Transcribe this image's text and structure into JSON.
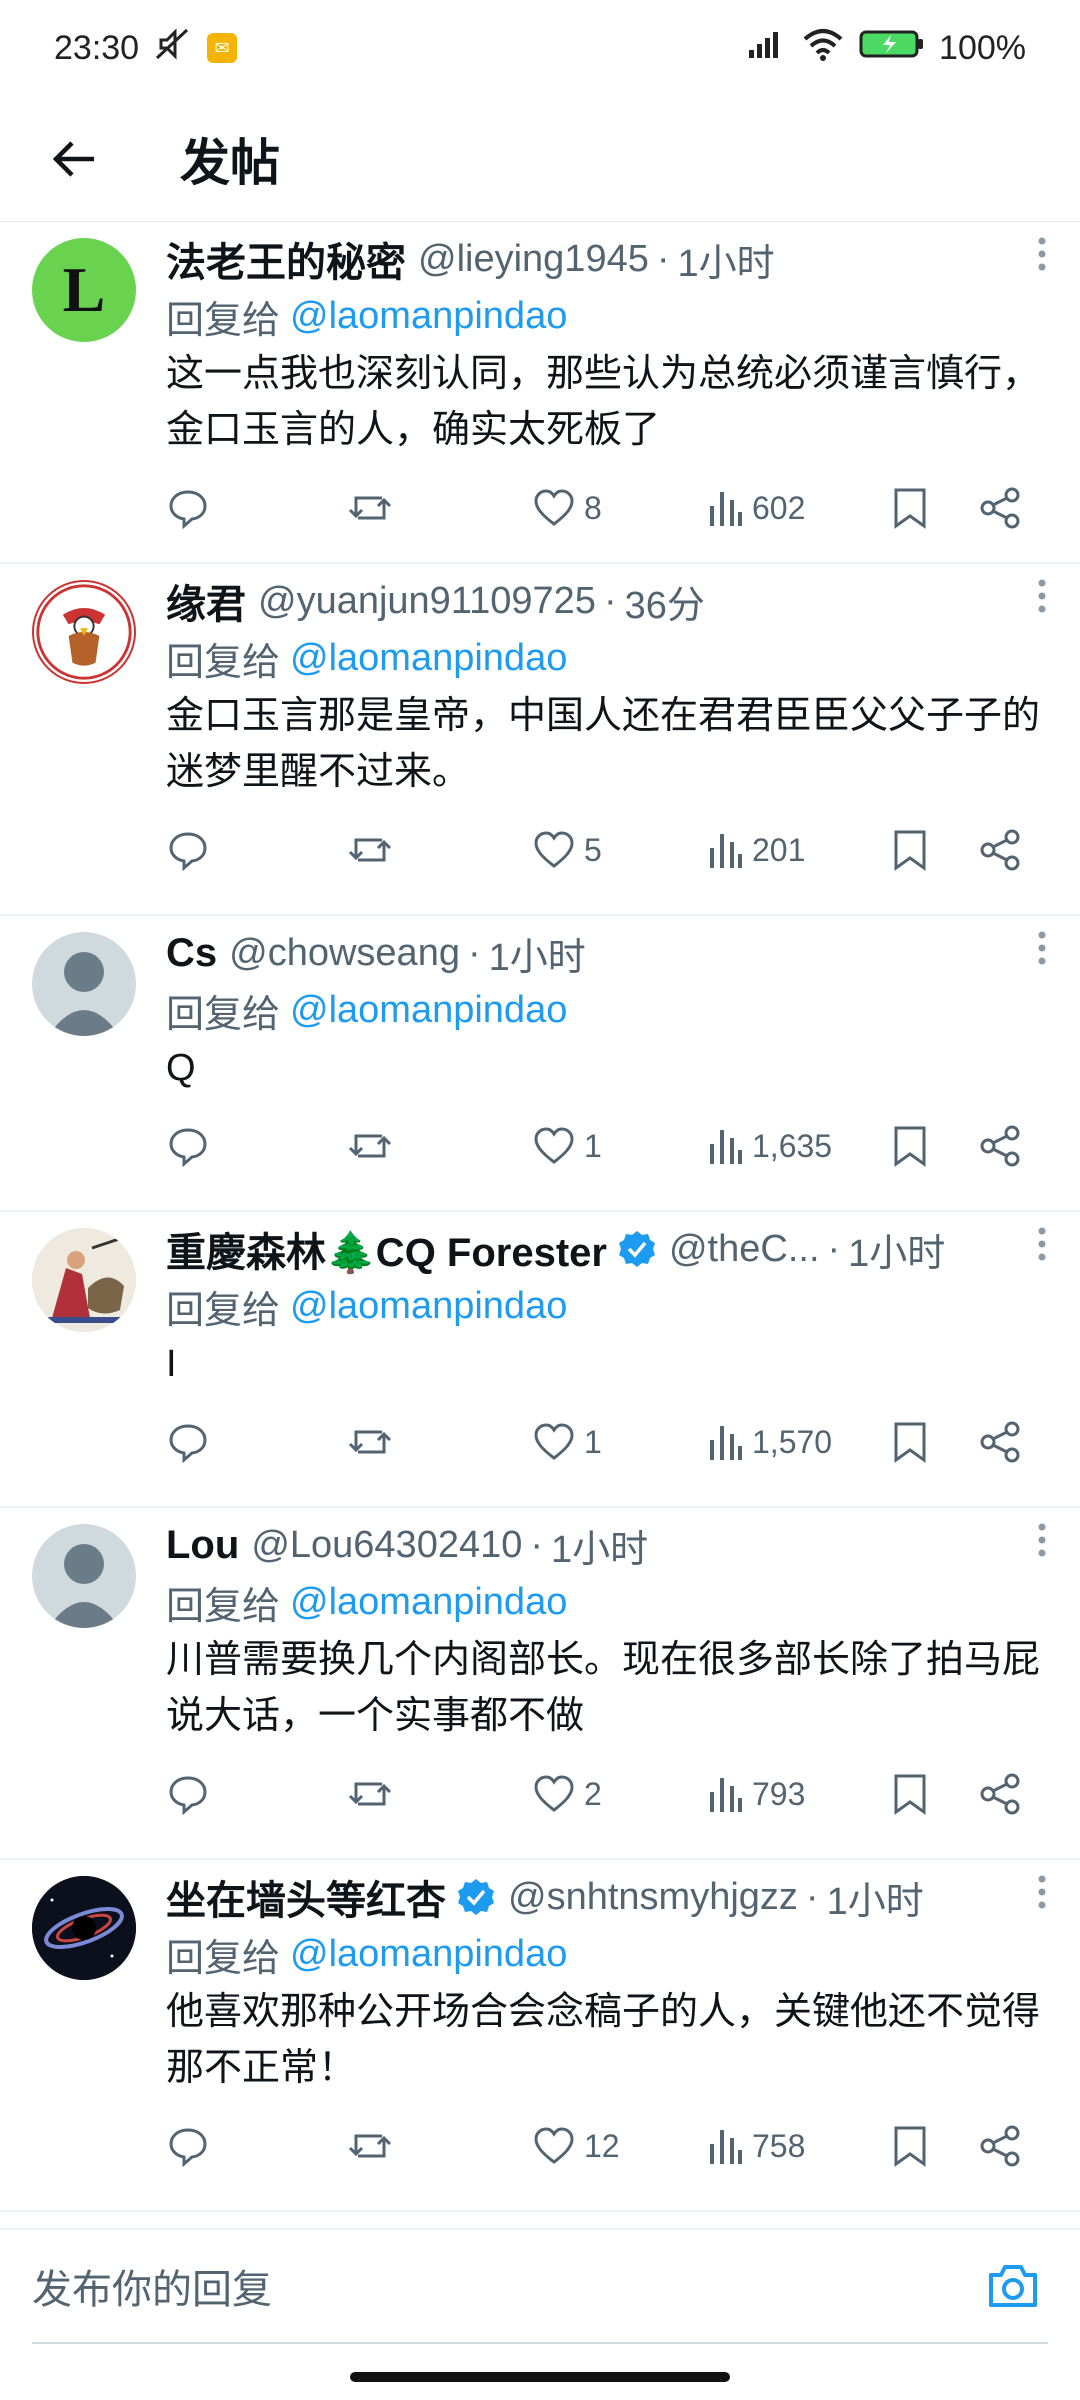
{
  "status_bar": {
    "time": "23:30",
    "battery": "100%"
  },
  "header": {
    "title": "发帖"
  },
  "reply_prefix": "回复给",
  "posts": [
    {
      "name": "法老王的秘密",
      "handle": "@lieying1945",
      "time": "1小时",
      "reply_to": "@laomanpindao",
      "text": "这一点我也深刻认同，那些认为总统必须谨言慎行，金口玉言的人，确实太死板了",
      "likes": "8",
      "views": "602",
      "avatar_letter": "L"
    },
    {
      "name": "缘君",
      "handle": "@yuanjun91109725",
      "time": "36分",
      "reply_to": "@laomanpindao",
      "text": "金口玉言那是皇帝，中国人还在君君臣臣父父子子的迷梦里醒不过来。",
      "likes": "5",
      "views": "201"
    },
    {
      "name": "Cs",
      "handle": "@chowseang",
      "time": "1小时",
      "reply_to": "@laomanpindao",
      "text": "Q",
      "likes": "1",
      "views": "1,635"
    },
    {
      "name": "重慶森林🌲CQ Forester",
      "handle": "@theC...",
      "time": "1小时",
      "reply_to": "@laomanpindao",
      "text": "I",
      "likes": "1",
      "views": "1,570"
    },
    {
      "name": "Lou",
      "handle": "@Lou64302410",
      "time": "1小时",
      "reply_to": "@laomanpindao",
      "text": "川普需要换几个内阁部长。现在很多部长除了拍马屁说大话，一个实事都不做",
      "likes": "2",
      "views": "793"
    },
    {
      "name": "坐在墙头等红杏",
      "handle": "@snhtnsmyhjgzz",
      "time": "1小时",
      "reply_to": "@laomanpindao",
      "text": "他喜欢那种公开场合会念稿子的人，关键他还不觉得那不正常！",
      "likes": "12",
      "views": "758"
    }
  ],
  "composer": {
    "placeholder": "发布你的回复"
  },
  "colors": {
    "link": "#1d9bf0",
    "secondary_text": "#536471",
    "primary_text": "#0f1419",
    "verified": "#1d9bf0"
  }
}
